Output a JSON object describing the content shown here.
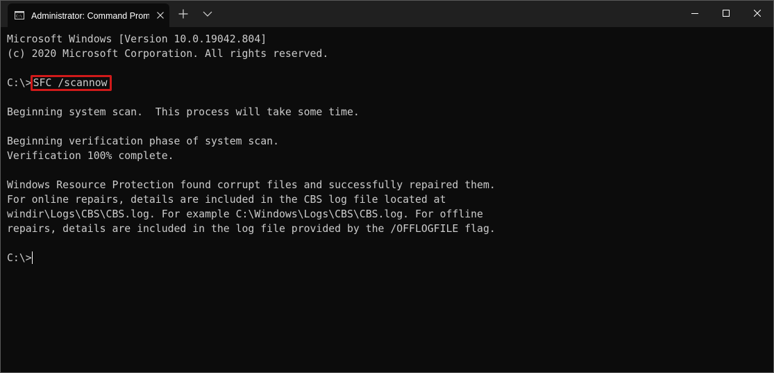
{
  "window": {
    "tab_title": "Administrator: Command Promp",
    "tab_icon": "cmd-icon",
    "caption_buttons": [
      "minimize-icon",
      "maximize-icon",
      "close-icon"
    ]
  },
  "terminal": {
    "line1": "Microsoft Windows [Version 10.0.19042.804]",
    "line2": "(c) 2020 Microsoft Corporation. All rights reserved.",
    "prompt1": "C:\\>",
    "command": "SFC /scannow",
    "line4": "Beginning system scan.  This process will take some time.",
    "line5": "Beginning verification phase of system scan.",
    "line6": "Verification 100% complete.",
    "line7": "Windows Resource Protection found corrupt files and successfully repaired them.",
    "line8": "For online repairs, details are included in the CBS log file located at",
    "line9": "windir\\Logs\\CBS\\CBS.log. For example C:\\Windows\\Logs\\CBS\\CBS.log. For offline",
    "line10": "repairs, details are included in the log file provided by the /OFFLOGFILE flag.",
    "prompt2": "C:\\>"
  },
  "colors": {
    "terminal_bg": "#0c0c0c",
    "titlebar_bg": "#202020",
    "text": "#cccccc",
    "highlight": "#d01a1a"
  }
}
